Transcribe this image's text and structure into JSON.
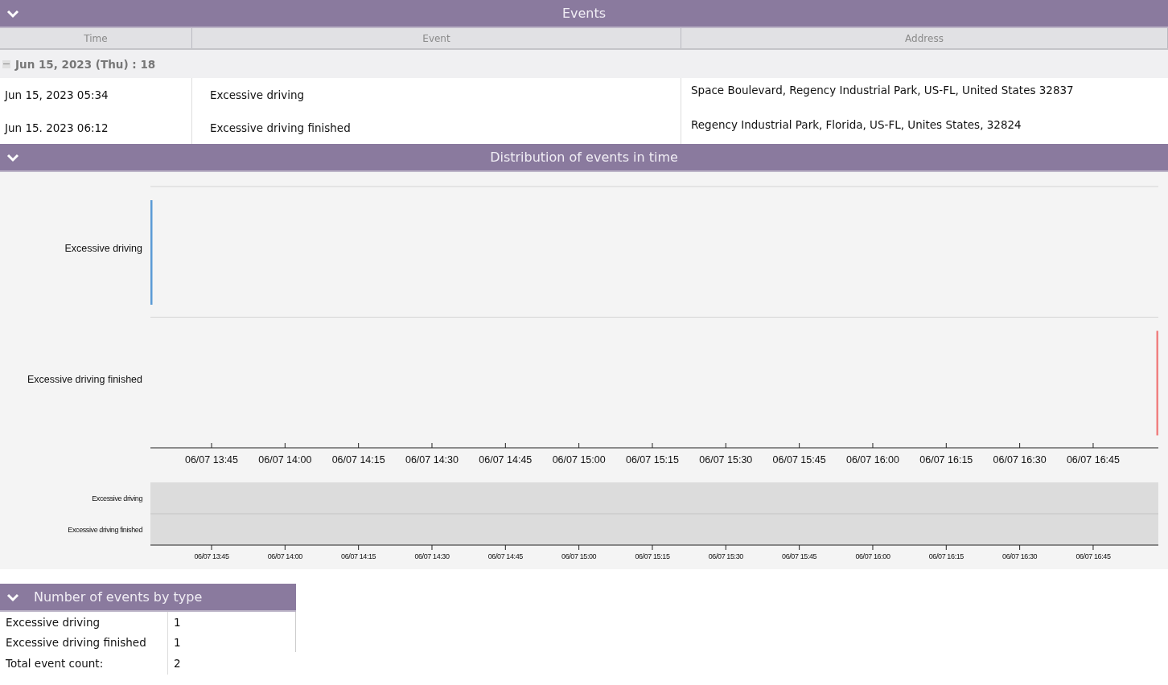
{
  "events_panel": {
    "title": "Events",
    "expanded": true,
    "columns": [
      "Time",
      "Event",
      "Address"
    ],
    "group": {
      "label": "Jun 15, 2023 (Thu) : 18",
      "expanded": true
    },
    "rows": [
      {
        "time": "Jun 15, 2023 05:34",
        "event": "Excessive driving",
        "address": "Space Boulevard, Regency Industrial Park, US-FL, United States 32837"
      },
      {
        "time": "Jun 15. 2023 06:12",
        "event": "Excessive driving finished",
        "address": "Regency Industrial Park, Florida, US-FL, Unites States, 32824"
      }
    ]
  },
  "distribution_panel": {
    "title": "Distribution of events in time",
    "expanded": true,
    "lanes": [
      {
        "label": "Excessive driving",
        "color": "#5b9bd5"
      },
      {
        "label": "Excessive driving finished",
        "color": "#f08080"
      }
    ],
    "ticks": [
      "06/07 13:45",
      "06/07 14:00",
      "06/07 14:15",
      "06/07 14:30",
      "06/07 14:45",
      "06/07 15:00",
      "06/07 15:15",
      "06/07 15:30",
      "06/07 15:45",
      "06/07 16:00",
      "06/07 16:15",
      "06/07 16:30",
      "06/07 16:45"
    ],
    "overview_lanes": [
      "Excessive driving",
      "Excessive driving finished"
    ],
    "overview_ticks": [
      "06/07 13:45",
      "06/07 14:00",
      "06/07 14:15",
      "06/07 14:30",
      "06/07 14:45",
      "06/07 15:00",
      "06/07 15:15",
      "06/07 15:30",
      "06/07 15:45",
      "06/07 16:00",
      "06/07 16:15",
      "06/07 16:30",
      "06/07 16:45"
    ]
  },
  "count_panel": {
    "title": "Number of events by type",
    "expanded": true,
    "rows": [
      {
        "type": "Excessive driving",
        "count": "1"
      },
      {
        "type": "Excessive driving finished",
        "count": "1"
      }
    ],
    "total": {
      "label": "Total event count:",
      "count": "2"
    }
  }
}
